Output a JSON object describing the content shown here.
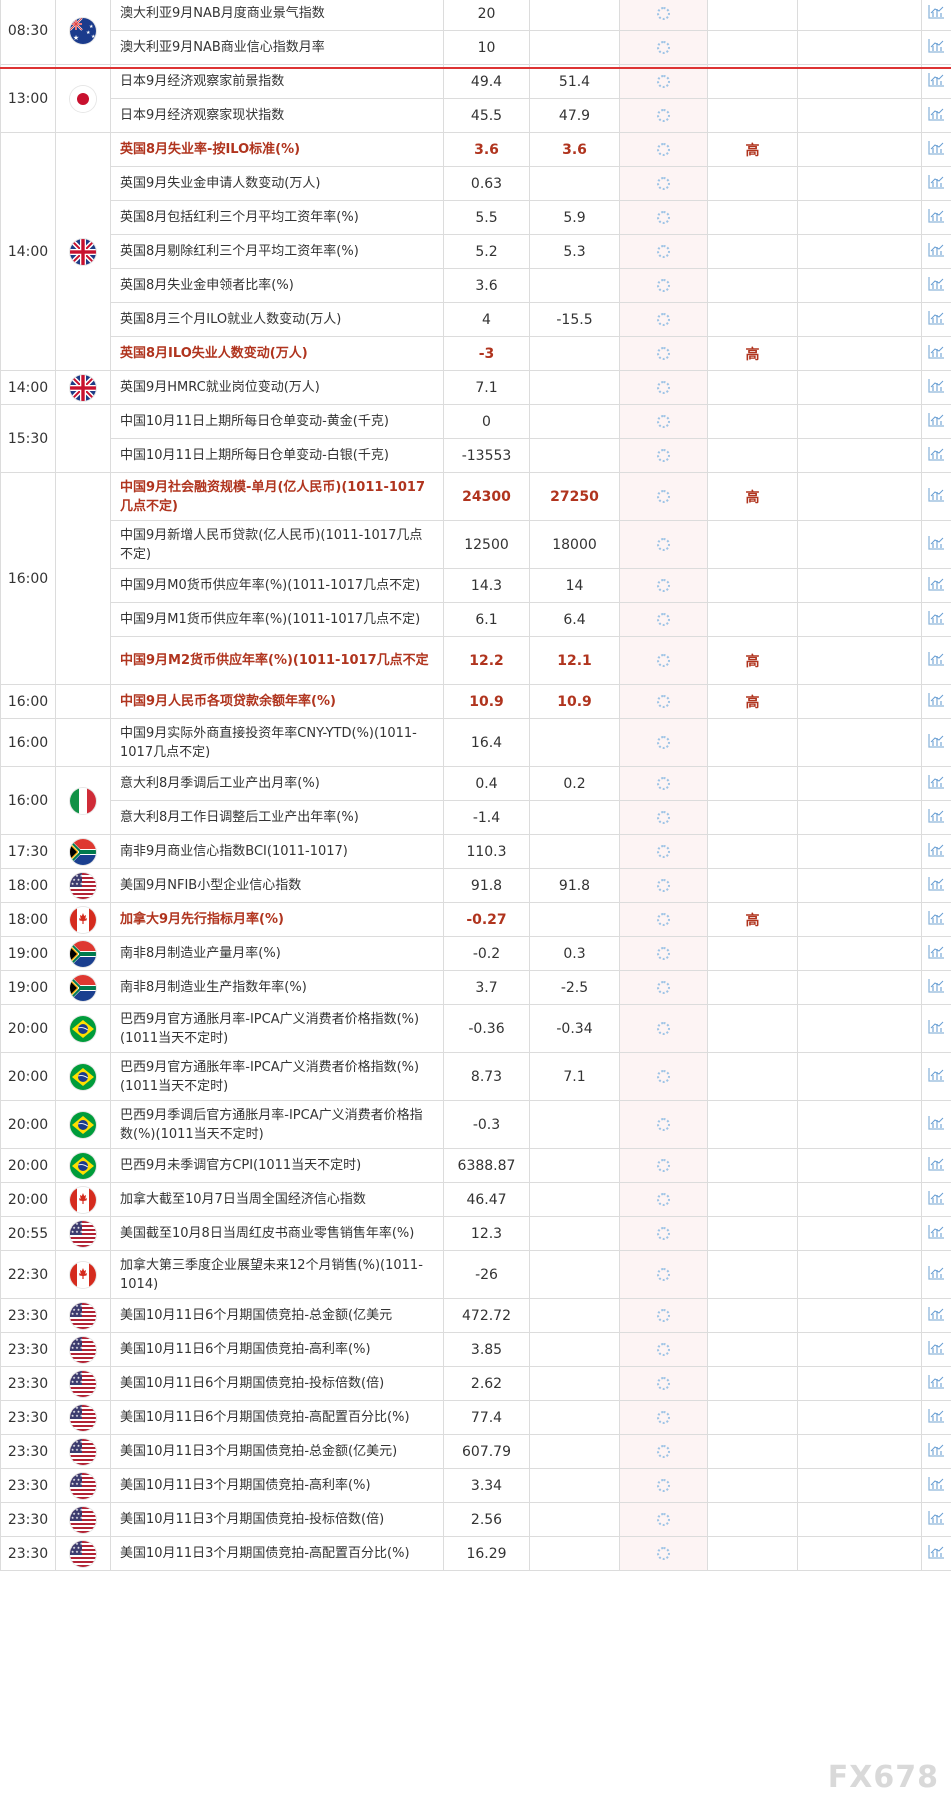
{
  "rows": [
    {
      "time": "08:30",
      "country": "AU",
      "event": "澳大利亚9月NAB月度商业景气指数",
      "prev": "20",
      "forecast": "",
      "importance": "",
      "hi": false
    },
    {
      "time": "",
      "country": "",
      "event": "澳大利亚9月NAB商业信心指数月率",
      "prev": "10",
      "forecast": "",
      "importance": "",
      "hi": false
    },
    {
      "time": "13:00",
      "country": "JP",
      "event": "日本9月经济观察家前景指数",
      "prev": "49.4",
      "forecast": "51.4",
      "importance": "",
      "hi": false
    },
    {
      "time": "",
      "country": "",
      "event": "日本9月经济观察家现状指数",
      "prev": "45.5",
      "forecast": "47.9",
      "importance": "",
      "hi": false
    },
    {
      "time": "14:00",
      "country": "UK",
      "event": "英国8月失业率-按ILO标准(%)",
      "prev": "3.6",
      "forecast": "3.6",
      "importance": "高",
      "hi": true
    },
    {
      "time": "",
      "country": "",
      "event": "英国9月失业金申请人数变动(万人)",
      "prev": "0.63",
      "forecast": "",
      "importance": "",
      "hi": false
    },
    {
      "time": "",
      "country": "",
      "event": "英国8月包括红利三个月平均工资年率(%)",
      "prev": "5.5",
      "forecast": "5.9",
      "importance": "",
      "hi": false
    },
    {
      "time": "",
      "country": "",
      "event": "英国8月剔除红利三个月平均工资年率(%)",
      "prev": "5.2",
      "forecast": "5.3",
      "importance": "",
      "hi": false
    },
    {
      "time": "",
      "country": "",
      "event": "英国8月失业金申领者比率(%)",
      "prev": "3.6",
      "forecast": "",
      "importance": "",
      "hi": false
    },
    {
      "time": "",
      "country": "",
      "event": "英国8月三个月ILO就业人数变动(万人)",
      "prev": "4",
      "forecast": "-15.5",
      "importance": "",
      "hi": false
    },
    {
      "time": "",
      "country": "",
      "event": "英国8月ILO失业人数变动(万人)",
      "prev": "-3",
      "forecast": "",
      "importance": "高",
      "hi": true
    },
    {
      "time": "14:00",
      "country": "UK",
      "event": "英国9月HMRC就业岗位变动(万人)",
      "prev": "7.1",
      "forecast": "",
      "importance": "",
      "hi": false
    },
    {
      "time": "15:30",
      "country": "",
      "event": "中国10月11日上期所每日仓单变动-黄金(千克)",
      "prev": "0",
      "forecast": "",
      "importance": "",
      "hi": false
    },
    {
      "time": "",
      "country": "",
      "event": "中国10月11日上期所每日仓单变动-白银(千克)",
      "prev": "-13553",
      "forecast": "",
      "importance": "",
      "hi": false
    },
    {
      "time": "16:00",
      "country": "",
      "event": "中国9月社会融资规模-单月(亿人民币)(1011-1017几点不定)",
      "prev": "24300",
      "forecast": "27250",
      "importance": "高",
      "hi": true
    },
    {
      "time": "",
      "country": "",
      "event": "中国9月新增人民币贷款(亿人民币)(1011-1017几点不定)",
      "prev": "12500",
      "forecast": "18000",
      "importance": "",
      "hi": false
    },
    {
      "time": "",
      "country": "",
      "event": "中国9月M0货币供应年率(%)(1011-1017几点不定)",
      "prev": "14.3",
      "forecast": "14",
      "importance": "",
      "hi": false
    },
    {
      "time": "",
      "country": "",
      "event": "中国9月M1货币供应年率(%)(1011-1017几点不定)",
      "prev": "6.1",
      "forecast": "6.4",
      "importance": "",
      "hi": false
    },
    {
      "time": "",
      "country": "",
      "event": "中国9月M2货币供应年率(%)(1011-1017几点不定",
      "prev": "12.2",
      "forecast": "12.1",
      "importance": "高",
      "hi": true
    },
    {
      "time": "16:00",
      "country": "",
      "event": "中国9月人民币各项贷款余额年率(%)",
      "prev": "10.9",
      "forecast": "10.9",
      "importance": "高",
      "hi": true
    },
    {
      "time": "16:00",
      "country": "",
      "event": "中国9月实际外商直接投资年率CNY-YTD(%)(1011-1017几点不定)",
      "prev": "16.4",
      "forecast": "",
      "importance": "",
      "hi": false
    },
    {
      "time": "16:00",
      "country": "IT",
      "event": "意大利8月季调后工业产出月率(%)",
      "prev": "0.4",
      "forecast": "0.2",
      "importance": "",
      "hi": false
    },
    {
      "time": "",
      "country": "",
      "event": "意大利8月工作日调整后工业产出年率(%)",
      "prev": "-1.4",
      "forecast": "",
      "importance": "",
      "hi": false
    },
    {
      "time": "17:30",
      "country": "ZA",
      "event": "南非9月商业信心指数BCI(1011-1017)",
      "prev": "110.3",
      "forecast": "",
      "importance": "",
      "hi": false
    },
    {
      "time": "18:00",
      "country": "US",
      "event": "美国9月NFIB小型企业信心指数",
      "prev": "91.8",
      "forecast": "91.8",
      "importance": "",
      "hi": false
    },
    {
      "time": "18:00",
      "country": "CA",
      "event": "加拿大9月先行指标月率(%)",
      "prev": "-0.27",
      "forecast": "",
      "importance": "高",
      "hi": true
    },
    {
      "time": "19:00",
      "country": "ZA",
      "event": "南非8月制造业产量月率(%)",
      "prev": "-0.2",
      "forecast": "0.3",
      "importance": "",
      "hi": false
    },
    {
      "time": "19:00",
      "country": "ZA",
      "event": "南非8月制造业生产指数年率(%)",
      "prev": "3.7",
      "forecast": "-2.5",
      "importance": "",
      "hi": false
    },
    {
      "time": "20:00",
      "country": "BR",
      "event": "巴西9月官方通胀月率-IPCA广义消费者价格指数(%)(1011当天不定时)",
      "prev": "-0.36",
      "forecast": "-0.34",
      "importance": "",
      "hi": false
    },
    {
      "time": "20:00",
      "country": "BR",
      "event": "巴西9月官方通胀年率-IPCA广义消费者价格指数(%)(1011当天不定时)",
      "prev": "8.73",
      "forecast": "7.1",
      "importance": "",
      "hi": false
    },
    {
      "time": "20:00",
      "country": "BR",
      "event": "巴西9月季调后官方通胀月率-IPCA广义消费者价格指数(%)(1011当天不定时)",
      "prev": "-0.3",
      "forecast": "",
      "importance": "",
      "hi": false
    },
    {
      "time": "20:00",
      "country": "BR",
      "event": "巴西9月未季调官方CPI(1011当天不定时)",
      "prev": "6388.87",
      "forecast": "",
      "importance": "",
      "hi": false
    },
    {
      "time": "20:00",
      "country": "CA",
      "event": "加拿大截至10月7日当周全国经济信心指数",
      "prev": "46.47",
      "forecast": "",
      "importance": "",
      "hi": false
    },
    {
      "time": "20:55",
      "country": "US",
      "event": "美国截至10月8日当周红皮书商业零售销售年率(%)",
      "prev": "12.3",
      "forecast": "",
      "importance": "",
      "hi": false
    },
    {
      "time": "22:30",
      "country": "CA",
      "event": "加拿大第三季度企业展望未来12个月销售(%)(1011-1014)",
      "prev": "-26",
      "forecast": "",
      "importance": "",
      "hi": false
    },
    {
      "time": "23:30",
      "country": "US",
      "event": "美国10月11日6个月期国债竞拍-总金额(亿美元",
      "prev": "472.72",
      "forecast": "",
      "importance": "",
      "hi": false
    },
    {
      "time": "23:30",
      "country": "US",
      "event": "美国10月11日6个月期国债竞拍-高利率(%)",
      "prev": "3.85",
      "forecast": "",
      "importance": "",
      "hi": false
    },
    {
      "time": "23:30",
      "country": "US",
      "event": "美国10月11日6个月期国债竞拍-投标倍数(倍)",
      "prev": "2.62",
      "forecast": "",
      "importance": "",
      "hi": false
    },
    {
      "time": "23:30",
      "country": "US",
      "event": "美国10月11日6个月期国债竞拍-高配置百分比(%)",
      "prev": "77.4",
      "forecast": "",
      "importance": "",
      "hi": false
    },
    {
      "time": "23:30",
      "country": "US",
      "event": "美国10月11日3个月期国债竞拍-总金额(亿美元)",
      "prev": "607.79",
      "forecast": "",
      "importance": "",
      "hi": false
    },
    {
      "time": "23:30",
      "country": "US",
      "event": "美国10月11日3个月期国债竞拍-高利率(%)",
      "prev": "3.34",
      "forecast": "",
      "importance": "",
      "hi": false
    },
    {
      "time": "23:30",
      "country": "US",
      "event": "美国10月11日3个月期国债竞拍-投标倍数(倍)",
      "prev": "2.56",
      "forecast": "",
      "importance": "",
      "hi": false
    },
    {
      "time": "23:30",
      "country": "US",
      "event": "美国10月11日3个月期国债竞拍-高配置百分比(%)",
      "prev": "16.29",
      "forecast": "",
      "importance": "",
      "hi": false
    }
  ],
  "watermark": "FX678",
  "colors": {
    "highlight": "#b0341e",
    "accent_line": "#dd3333",
    "spinner": "#9ec4e6",
    "chart_icon": "#8fb6db"
  }
}
